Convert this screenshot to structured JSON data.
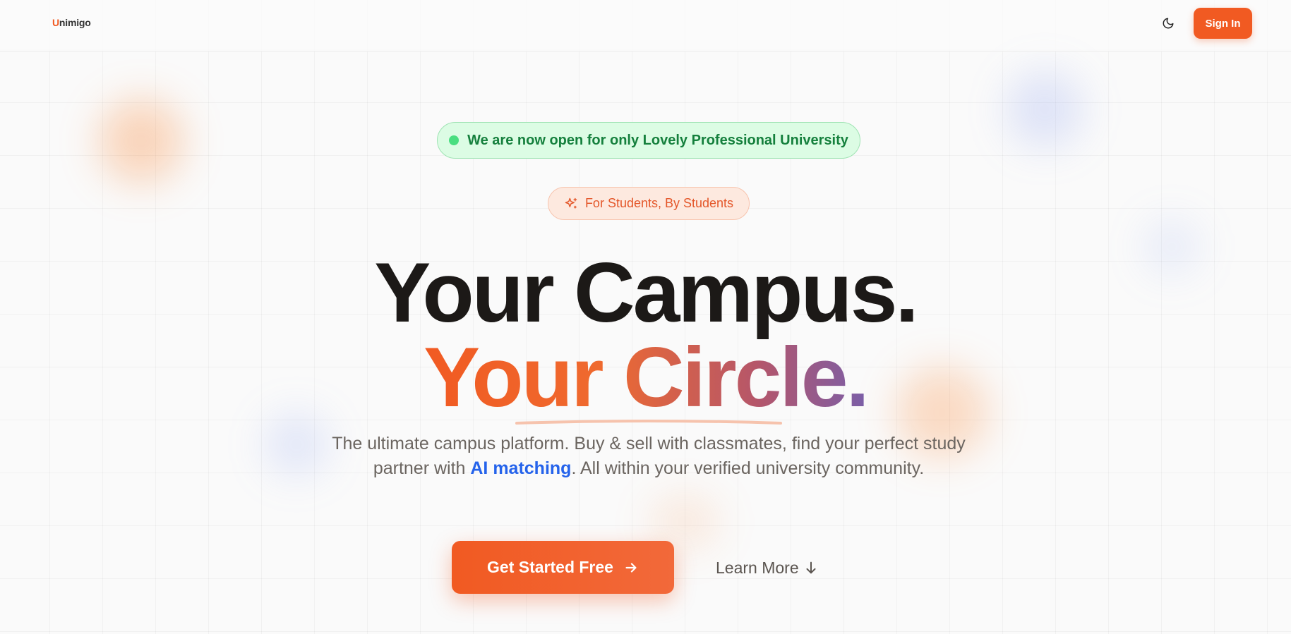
{
  "header": {
    "logo_u": "U",
    "logo_rest": "nimigo",
    "signin_label": "Sign In"
  },
  "announcement": {
    "text": "We are now open for only Lovely Professional University"
  },
  "tagline_badge": {
    "text": "For Students, By Students"
  },
  "hero": {
    "line1": "Your Campus.",
    "line2": "Your Circle.",
    "subtitle_part1": "The ultimate campus platform. Buy & sell with classmates, find your perfect study partner with ",
    "subtitle_highlight": "AI matching",
    "subtitle_part2": ". All within your verified university community."
  },
  "actions": {
    "primary_label": "Get Started Free",
    "secondary_label": "Learn More"
  },
  "colors": {
    "brand_orange": "#f15a22",
    "success_green": "#15803d",
    "link_blue": "#2563eb",
    "gradient_end_purple": "#7a5ea8"
  },
  "icons": {
    "theme": "moon-icon",
    "badge": "sparkles-icon",
    "cta": "arrow-right-icon",
    "learn": "arrow-down-icon"
  }
}
